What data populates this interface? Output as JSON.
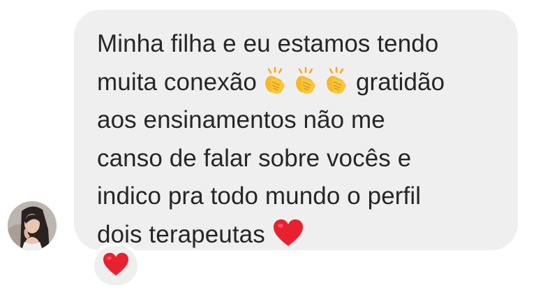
{
  "conversation": {
    "message": {
      "lines": [
        "Minha filha e eu estamos tendo",
        "muita conexão",
        "gratidão",
        "aos ensinamentos não me",
        "canso de falar sobre vocês e",
        "indico pra todo mundo o perfil",
        "dois terapeutas"
      ],
      "emoji_inline": [
        "clapping-hands",
        "clapping-hands",
        "clapping-hands"
      ],
      "emoji_end": "red-heart"
    },
    "reaction": {
      "emoji": "red-heart"
    },
    "sender": {
      "avatar": "profile-photo"
    }
  },
  "colors": {
    "bubble_background": "#efefef",
    "text": "#262626",
    "heart": "#e8212e",
    "clap": "#f5b92a",
    "page_background": "#ffffff"
  }
}
